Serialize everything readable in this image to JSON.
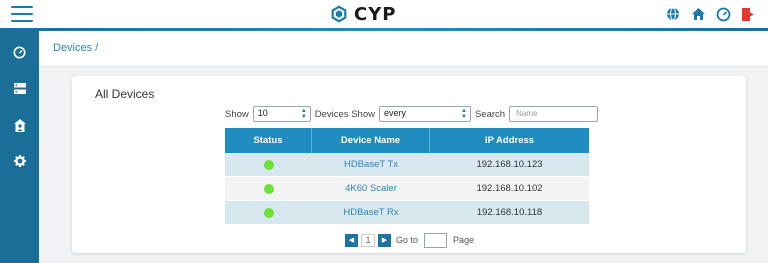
{
  "header": {
    "brand": "CYP",
    "icons": [
      "globe-icon",
      "home-icon",
      "gauge-icon",
      "logout-icon"
    ]
  },
  "sidebar": {
    "items": [
      {
        "icon": "gauge-icon"
      },
      {
        "icon": "server-icon"
      },
      {
        "icon": "house-person-icon"
      },
      {
        "icon": "gear-icon"
      }
    ]
  },
  "breadcrumb": "Devices /",
  "card": {
    "title": "All Devices",
    "show_label": "Show",
    "show_value": "10",
    "devices_show_label": "Devices Show",
    "filter_value": "every",
    "search_label": "Search",
    "search_placeholder": "Name"
  },
  "table": {
    "headers": [
      "Status",
      "Device Name",
      "IP Address"
    ],
    "rows": [
      {
        "status": "online",
        "name": "HDBaseT Tx",
        "ip": "192.168.10.123"
      },
      {
        "status": "online",
        "name": "4K60 Scaler",
        "ip": "192.168.10.102"
      },
      {
        "status": "online",
        "name": "HDBaseT Rx",
        "ip": "192.168.10.118"
      }
    ]
  },
  "pagination": {
    "current_page": "1",
    "goto_label": "Go to",
    "page_label": "Page"
  },
  "colors": {
    "accent": "#1b6e98",
    "table_header": "#1f8dbf",
    "status_online": "#6fe23a",
    "logout": "#e03a2f"
  }
}
